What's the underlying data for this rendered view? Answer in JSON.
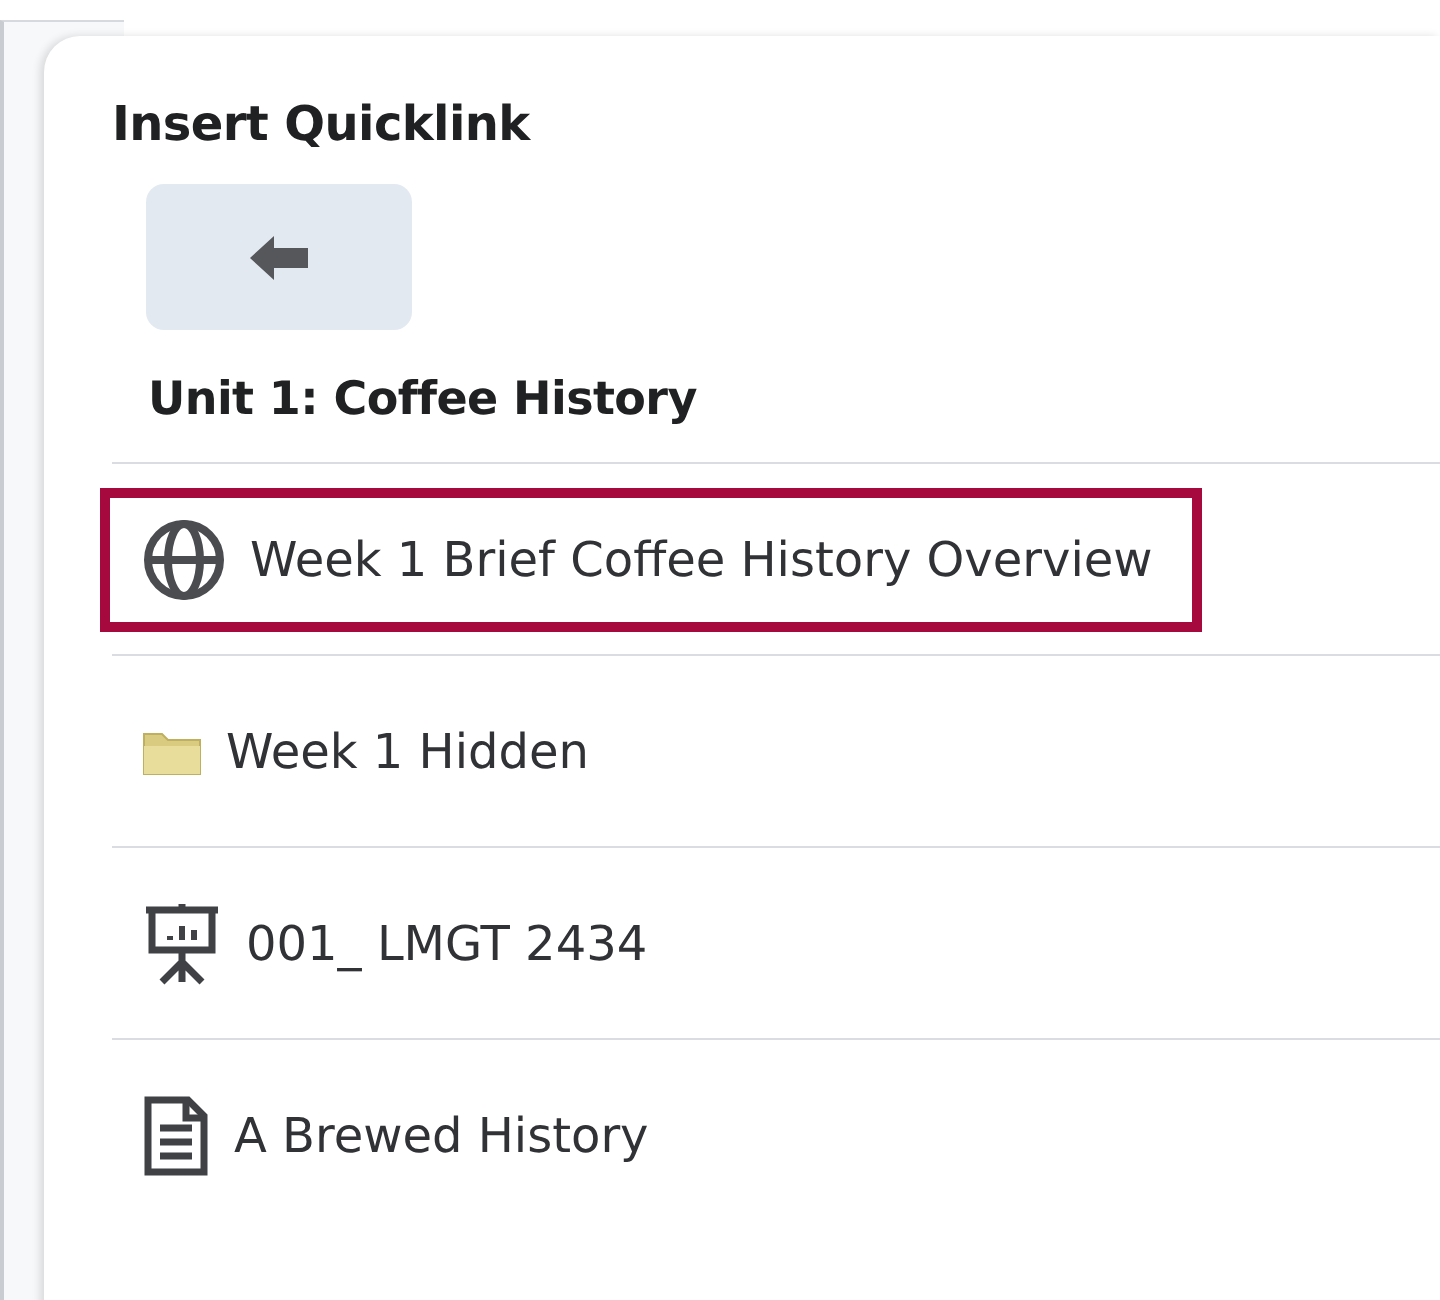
{
  "dialog": {
    "title": "Insert Quicklink",
    "heading": "Unit 1: Coffee History",
    "items": [
      {
        "kind": "web",
        "label": "Week 1 Brief Coffee History Overview",
        "highlighted": true
      },
      {
        "kind": "folder",
        "label": "Week 1 Hidden",
        "highlighted": false
      },
      {
        "kind": "presentation",
        "label": "001_ LMGT 2434",
        "highlighted": false
      },
      {
        "kind": "document",
        "label": "A Brewed History",
        "highlighted": false
      }
    ]
  }
}
